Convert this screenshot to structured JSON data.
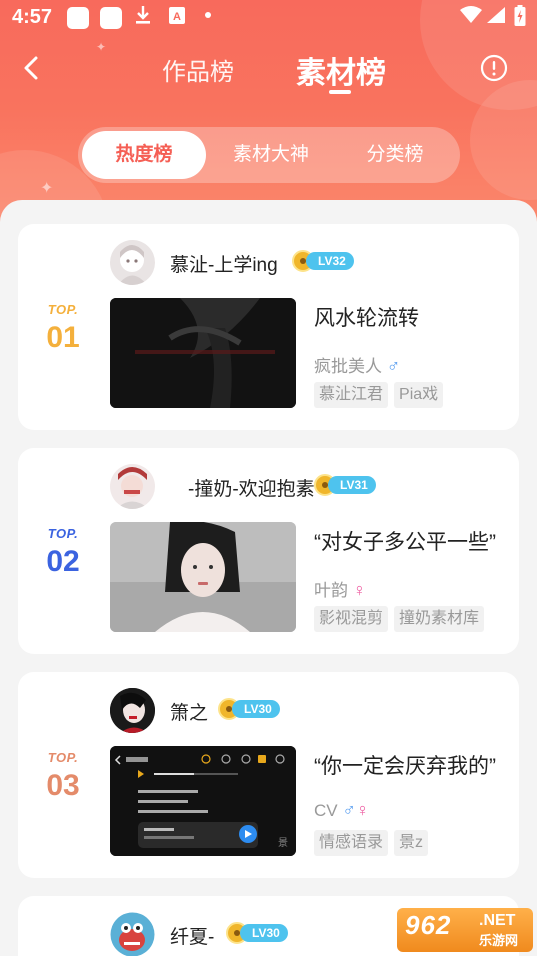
{
  "status": {
    "time": "4:57"
  },
  "nav": {
    "tabs": [
      {
        "label": "作品榜"
      },
      {
        "label": "素材榜"
      }
    ]
  },
  "segment": {
    "items": [
      {
        "label": "热度榜"
      },
      {
        "label": "素材大神"
      },
      {
        "label": "分类榜"
      }
    ],
    "selected": "热度榜"
  },
  "colors": {
    "header": "#f86a5c",
    "rank1": "#f4b03c",
    "rank2": "#3b63e0",
    "rank3": "#e48b6a",
    "level_badge": "#4ec3ee"
  },
  "cards": [
    {
      "rank_top": "TOP.",
      "rank": "01",
      "username": "慕沚-上学ing",
      "level": "LV32",
      "title": "风水轮流转",
      "author": "疯批美人",
      "gender_icons": [
        "male-icon"
      ],
      "tags": [
        "慕沚江君",
        "Pia戏"
      ]
    },
    {
      "rank_top": "TOP.",
      "rank": "02",
      "username": "-撞奶-欢迎抱素",
      "level": "LV31",
      "title": "“对女子多公平一些”",
      "author": "叶韵",
      "gender_icons": [
        "female-icon"
      ],
      "tags": [
        "影视混剪",
        "撞奶素材库"
      ]
    },
    {
      "rank_top": "TOP.",
      "rank": "03",
      "username": "箫之",
      "level": "LV30",
      "title": "“你一定会厌弃我的”",
      "author": "CV",
      "gender_icons": [
        "male-icon",
        "female-icon"
      ],
      "tags": [
        "情感语录",
        "景z"
      ]
    },
    {
      "username": "纤夏-",
      "level": "LV30"
    }
  ],
  "watermark": {
    "number": "962",
    "net": ".NET",
    "sub": "乐游网"
  }
}
